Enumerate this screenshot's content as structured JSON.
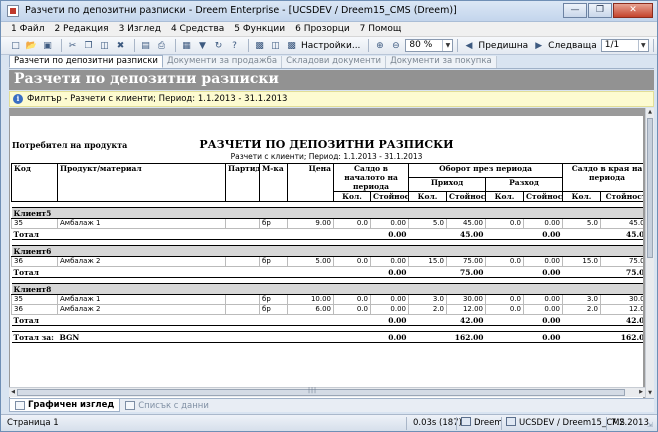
{
  "window": {
    "title": "Разчети по депозитни разписки - Dreem Enterprise - [UCSDEV / Dreem15_CMS (Dreem)]"
  },
  "menu": [
    "1 Файл",
    "2 Редакция",
    "3 Изглед",
    "4 Средства",
    "5 Функции",
    "6 Прозорци",
    "7 Помощ"
  ],
  "toolbar": {
    "settings_label": "Настройки...",
    "zoom_value": "80 %",
    "prev_label": "Предишна",
    "next_label": "Следваща",
    "page_value": "1/1"
  },
  "doc_tabs": [
    "Разчети по депозитни разписки",
    "Документи за продажба",
    "Складови документи",
    "Документи за покупка"
  ],
  "header": {
    "title": "Разчети по депозитни разписки",
    "filter": "Филтър - Разчети с клиенти; Период: 1.1.2013 - 31.1.2013"
  },
  "report": {
    "consumer_label": "Потребител на продукта",
    "title": "РАЗЧЕТИ ПО ДЕПОЗИТНИ РАЗПИСКИ",
    "subtitle": "Разчети с клиенти; Период: 1.1.2013 - 31.1.2013",
    "columns": {
      "code": "Код",
      "product": "Продукт/материал",
      "batch": "Партида",
      "unit": "М-ка",
      "price": "Цена",
      "opening": "Салдо в началото на периода",
      "turnover": "Оборот през периода",
      "income": "Приход",
      "expense": "Разход",
      "closing": "Салдо в края на периода",
      "qty": "Кол.",
      "value": "Стойност"
    },
    "groups": [
      {
        "name": "Клиент5",
        "rows": [
          {
            "code": "35",
            "product": "Амбалаж 1",
            "unit": "бр",
            "price": "9.00",
            "oq": "0.0",
            "ov": "0.00",
            "iq": "5.0",
            "iv": "45.00",
            "eq": "0.0",
            "ev": "0.00",
            "cq": "5.0",
            "cv": "45.00"
          }
        ],
        "total": {
          "label": "Тотал",
          "ov": "0.00",
          "iv": "45.00",
          "ev": "0.00",
          "cv": "45.00"
        }
      },
      {
        "name": "Клиент6",
        "rows": [
          {
            "code": "36",
            "product": "Амбалаж 2",
            "unit": "бр",
            "price": "5.00",
            "oq": "0.0",
            "ov": "0.00",
            "iq": "15.0",
            "iv": "75.00",
            "eq": "0.0",
            "ev": "0.00",
            "cq": "15.0",
            "cv": "75.00"
          }
        ],
        "total": {
          "label": "Тотал",
          "ov": "0.00",
          "iv": "75.00",
          "ev": "0.00",
          "cv": "75.00"
        }
      },
      {
        "name": "Клиент8",
        "rows": [
          {
            "code": "35",
            "product": "Амбалаж 1",
            "unit": "бр",
            "price": "10.00",
            "oq": "0.0",
            "ov": "0.00",
            "iq": "3.0",
            "iv": "30.00",
            "eq": "0.0",
            "ev": "0.00",
            "cq": "3.0",
            "cv": "30.00"
          },
          {
            "code": "36",
            "product": "Амбалаж 2",
            "unit": "бр",
            "price": "6.00",
            "oq": "0.0",
            "ov": "0.00",
            "iq": "2.0",
            "iv": "12.00",
            "eq": "0.0",
            "ev": "0.00",
            "cq": "2.0",
            "cv": "12.00"
          }
        ],
        "total": {
          "label": "Тотал",
          "ov": "0.00",
          "iv": "42.00",
          "ev": "0.00",
          "cv": "42.00"
        }
      }
    ],
    "grand_total": {
      "label": "Тотал за:",
      "currency": "BGN",
      "ov": "0.00",
      "iv": "162.00",
      "ev": "0.00",
      "cv": "162.00"
    }
  },
  "view_tabs": [
    "Графичен изглед",
    "Списък с данни"
  ],
  "status": {
    "page": "Страница 1",
    "timing": "0.03s (187)",
    "app": "Dreem",
    "connection": "UCSDEV / Dreem15_CMS",
    "date": "7.2.2013"
  }
}
